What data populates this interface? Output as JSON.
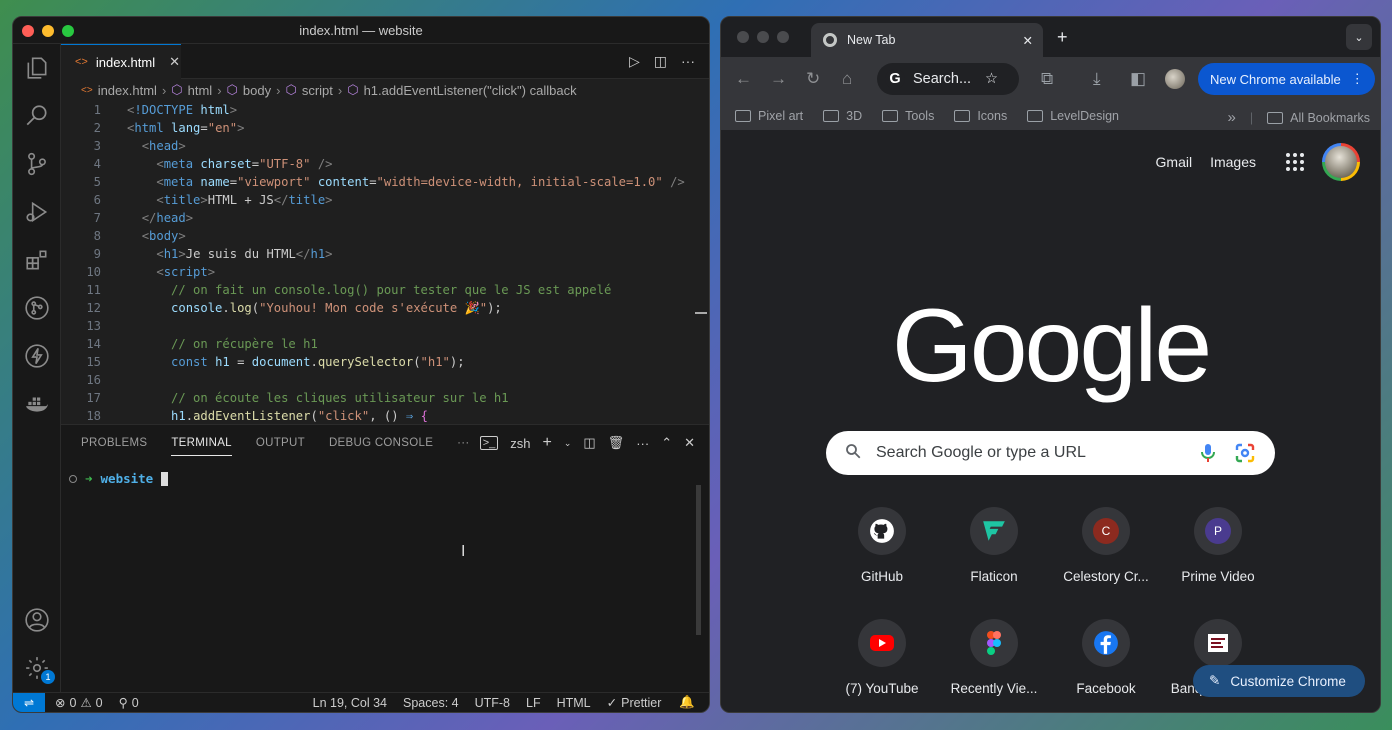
{
  "vscode": {
    "window_title": "index.html — website",
    "tab_label": "index.html",
    "breadcrumbs": [
      "index.html",
      "html",
      "body",
      "script",
      "h1.addEventListener(\"click\") callback"
    ],
    "line_numbers": [
      "1",
      "2",
      "3",
      "4",
      "5",
      "6",
      "7",
      "8",
      "9",
      "10",
      "11",
      "12",
      "13",
      "14",
      "15",
      "16",
      "17",
      "18"
    ],
    "panel_tabs": [
      "PROBLEMS",
      "TERMINAL",
      "OUTPUT",
      "DEBUG CONSOLE"
    ],
    "terminal_shell": "zsh",
    "terminal_dir": "website",
    "status": {
      "errors": "0",
      "warnings": "0",
      "ports": "0",
      "cursor": "Ln 19, Col 34",
      "spaces": "Spaces: 4",
      "encoding": "UTF-8",
      "eol": "LF",
      "language": "HTML",
      "formatter": "Prettier",
      "settings_badge": "1"
    }
  },
  "chrome": {
    "tab_title": "New Tab",
    "omnibox_text": "Search...",
    "update_button": "New Chrome available",
    "bookmarks": [
      "Pixel art",
      "3D",
      "Tools",
      "Icons",
      "LevelDesign"
    ],
    "all_bookmarks": "All Bookmarks",
    "gmail": "Gmail",
    "images": "Images",
    "logo": "Google",
    "search_placeholder": "Search Google or type a URL",
    "shortcuts": [
      {
        "label": "GitHub"
      },
      {
        "label": "Flaticon"
      },
      {
        "label": "Celestory Cr...",
        "letter": "C"
      },
      {
        "label": "Prime Video",
        "letter": "P"
      },
      {
        "label": "(7) YouTube"
      },
      {
        "label": "Recently Vie..."
      },
      {
        "label": "Facebook"
      },
      {
        "label": "Banque a Acc..."
      }
    ],
    "customize_button": "Customize Chrome"
  },
  "colors": {
    "vscode_accent": "#0078d4",
    "chrome_update": "#0b57d0",
    "terminal_dir": "#4fb0e8"
  }
}
